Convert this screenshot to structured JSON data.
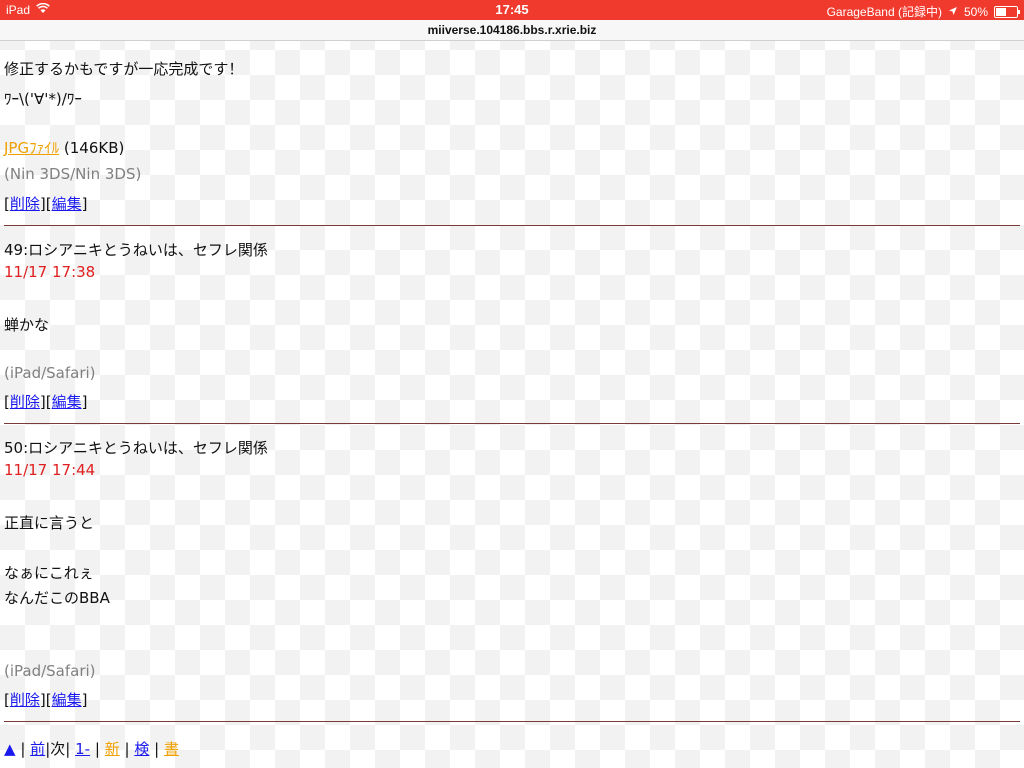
{
  "status": {
    "device": "iPad",
    "time": "17:45",
    "app": "GarageBand (記録中)",
    "battery": "50%",
    "battery_level": 0.5
  },
  "url": "miiverse.104186.bbs.r.xrie.biz",
  "post_prev": {
    "line1": "修正するかもですが一応完成です！",
    "line2": "ﾜｰ\\('∀'*)/ﾜｰ",
    "attachment_label": "JPGﾌｧｲﾙ",
    "attachment_size": "(146KB)",
    "device": "(Nin 3DS/Nin 3DS)"
  },
  "post49": {
    "header": "49:ロシアニキとうねいは、セフレ関係",
    "date": "11/17 17:38",
    "body1": "蝉かな",
    "device": "(iPad/Safari)"
  },
  "post50": {
    "header": "50:ロシアニキとうねいは、セフレ関係",
    "date": "11/17 17:44",
    "body1": "正直に言うと",
    "body2": "なぁにこれぇ",
    "body3": "なんだこのBBA",
    "device": "(iPad/Safari)"
  },
  "actions": {
    "delete": "削除",
    "edit": "編集"
  },
  "nav": {
    "top": "▲",
    "prev": "前",
    "next": "次",
    "first": "1-",
    "new": "新",
    "search": "検",
    "write": "書"
  }
}
